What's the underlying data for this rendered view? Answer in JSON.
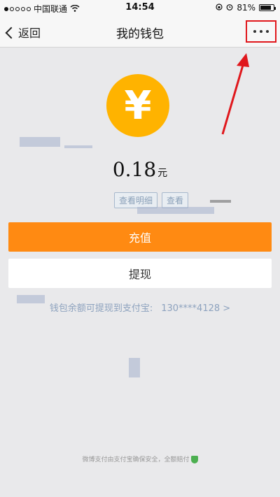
{
  "status_bar": {
    "carrier": "中国联通",
    "time": "14:54",
    "battery_percent": "81%",
    "battery_level": 0.81,
    "icons": [
      "signal-icon",
      "wifi-icon",
      "lock-rotation-icon",
      "alarm-icon",
      "battery-icon"
    ]
  },
  "nav": {
    "back_label": "返回",
    "title": "我的钱包",
    "more_icon": "more-dots-icon"
  },
  "wallet": {
    "coin_symbol": "¥",
    "balance": "0.18",
    "unit": "元",
    "detail_link": "查看明细",
    "detail_link_2": "查看"
  },
  "actions": {
    "recharge": "充值",
    "withdraw": "提现"
  },
  "hint": {
    "text": "钱包余额可提现到支付宝:",
    "account": "130****4128 >"
  },
  "footer": {
    "text": "微博支付由支付宝确保安全，全额赔付"
  },
  "colors": {
    "accent": "#ff8a12",
    "coin": "#ffb300",
    "highlight_box": "#e0171c"
  }
}
